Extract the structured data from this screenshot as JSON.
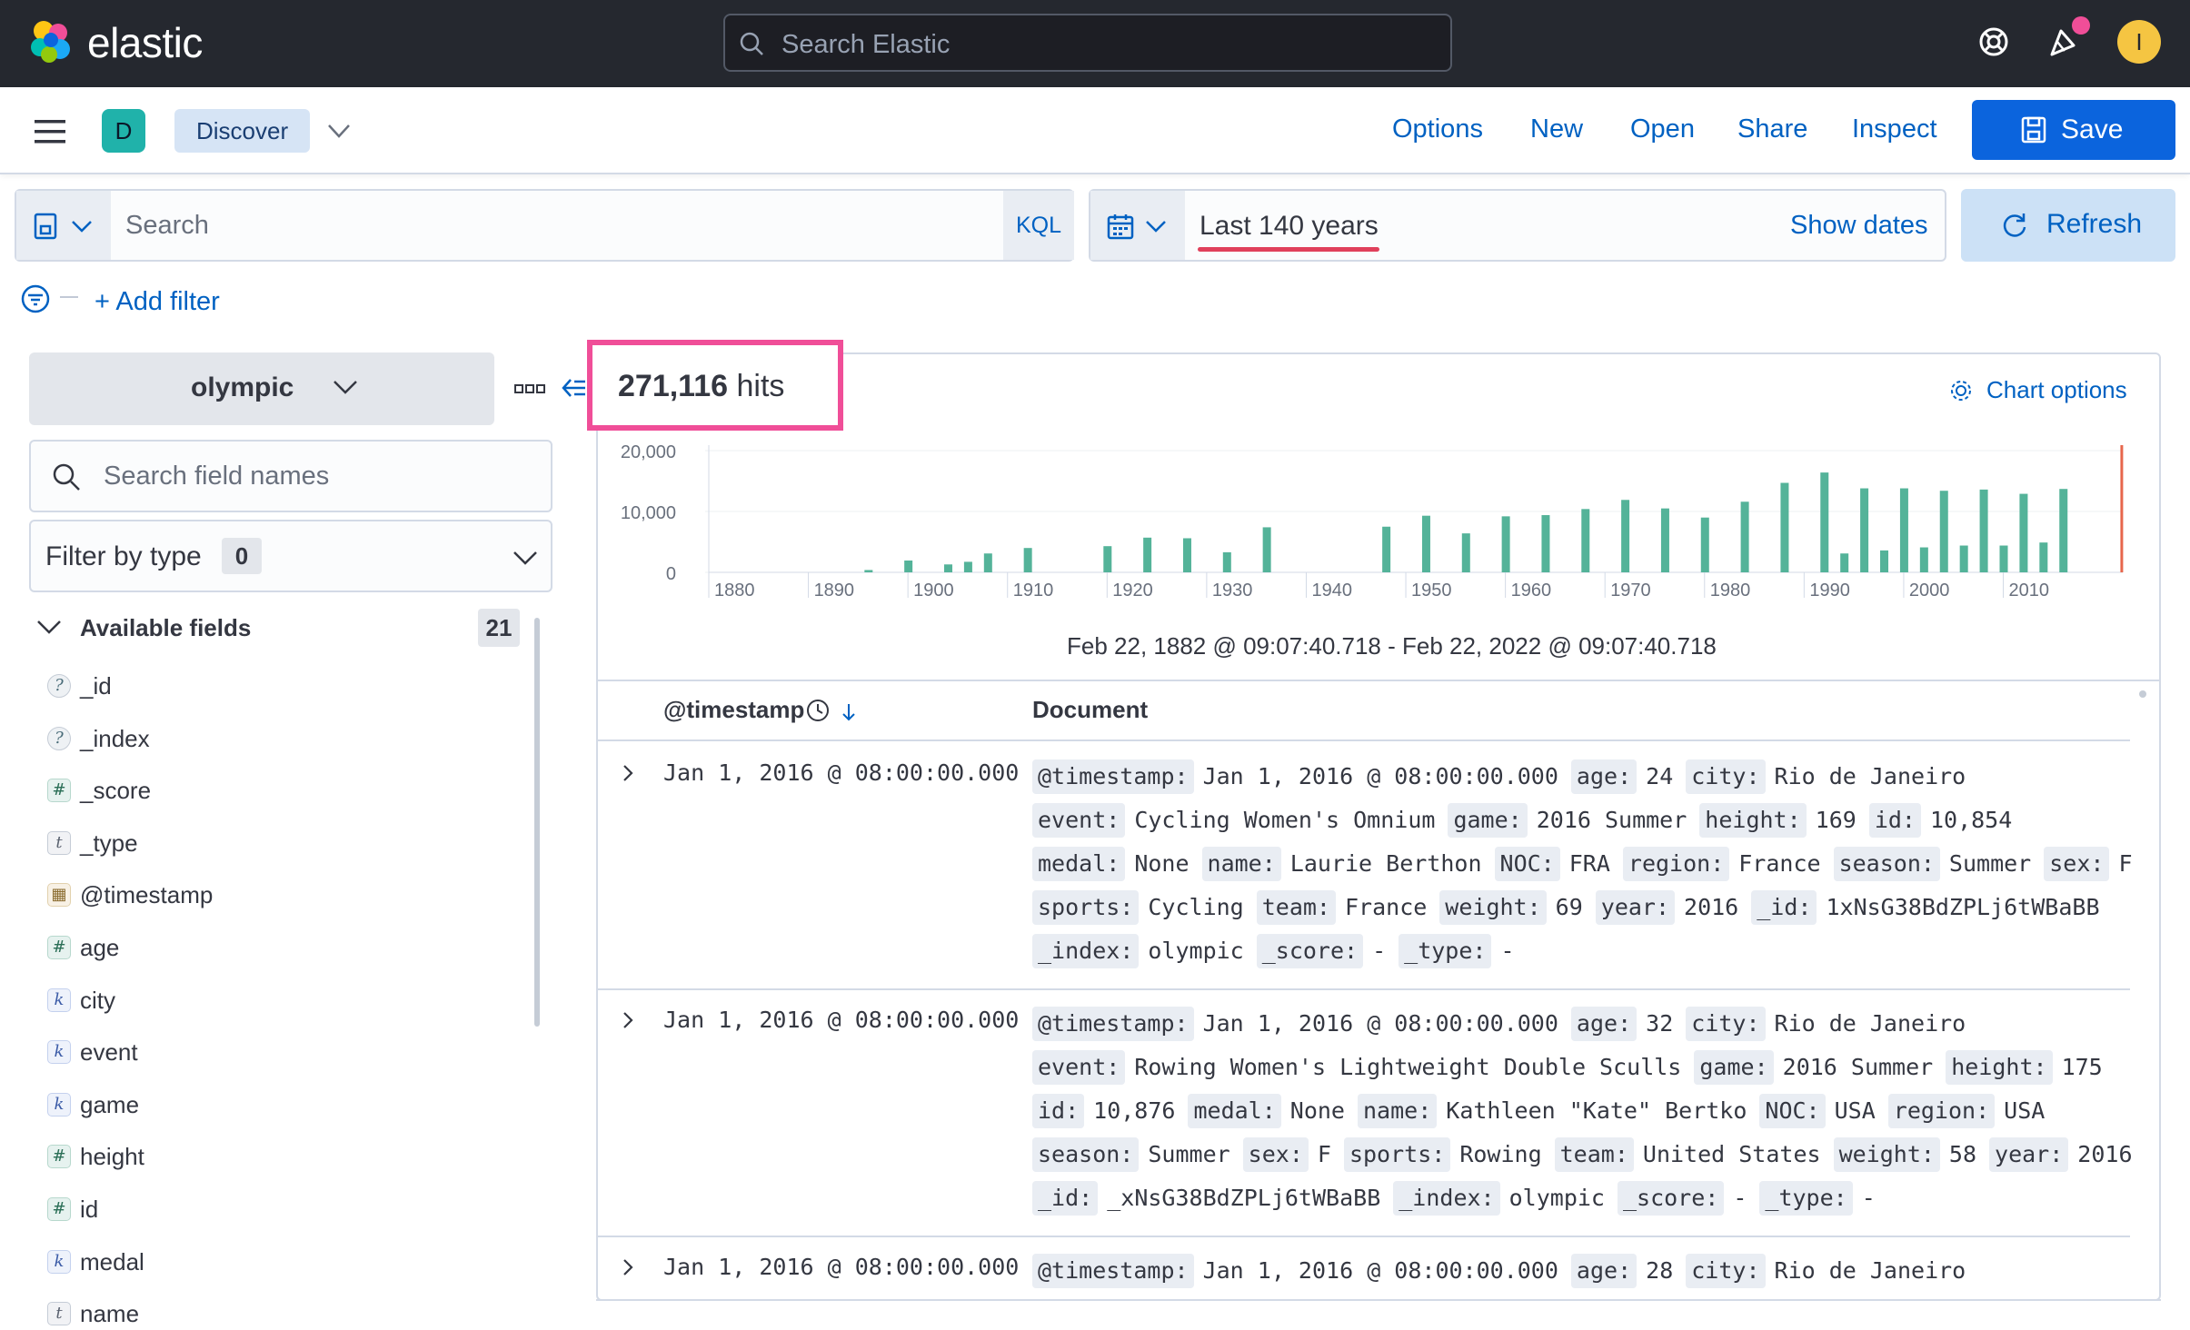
{
  "header": {
    "logo_text": "elastic",
    "search_placeholder": "Search Elastic",
    "user_initial": "I"
  },
  "appbar": {
    "space_initial": "D",
    "breadcrumb": "Discover",
    "nav": [
      "Options",
      "New",
      "Open",
      "Share",
      "Inspect"
    ],
    "save_label": "Save"
  },
  "query": {
    "placeholder": "Search",
    "language": "KQL",
    "date_range": "Last 140 years",
    "show_dates": "Show dates",
    "refresh_label": "Refresh",
    "add_filter": "+ Add filter"
  },
  "sidebar": {
    "index_pattern": "olympic",
    "field_search_placeholder": "Search field names",
    "filter_by_type": "Filter by type",
    "filter_count": "0",
    "available_label": "Available fields",
    "available_count": "21",
    "fields": [
      {
        "type": "q",
        "badge": "?",
        "name": "_id"
      },
      {
        "type": "q",
        "badge": "?",
        "name": "_index"
      },
      {
        "type": "num",
        "badge": "#",
        "name": "_score"
      },
      {
        "type": "txt",
        "badge": "t",
        "name": "_type"
      },
      {
        "type": "date",
        "badge": "▦",
        "name": "@timestamp"
      },
      {
        "type": "num",
        "badge": "#",
        "name": "age"
      },
      {
        "type": "kw",
        "badge": "k",
        "name": "city"
      },
      {
        "type": "kw",
        "badge": "k",
        "name": "event"
      },
      {
        "type": "kw",
        "badge": "k",
        "name": "game"
      },
      {
        "type": "num",
        "badge": "#",
        "name": "height"
      },
      {
        "type": "num",
        "badge": "#",
        "name": "id"
      },
      {
        "type": "kw",
        "badge": "k",
        "name": "medal"
      },
      {
        "type": "txt",
        "badge": "t",
        "name": "name"
      }
    ]
  },
  "main": {
    "hits_count": "271,116",
    "hits_word": "hits",
    "chart_options": "Chart options",
    "range_label": "Feb 22, 1882 @ 09:07:40.718 - Feb 22, 2022 @ 09:07:40.718",
    "columns": {
      "timestamp": "@timestamp",
      "document": "Document"
    },
    "rows": [
      {
        "timestamp": "Jan 1, 2016 @ 08:00:00.000",
        "lines": [
          [
            [
              "@timestamp:",
              "Jan 1, 2016 @ 08:00:00.000"
            ],
            [
              "age:",
              "24"
            ],
            [
              "city:",
              "Rio de Janeiro"
            ]
          ],
          [
            [
              "event:",
              "Cycling Women's Omnium"
            ],
            [
              "game:",
              "2016 Summer"
            ],
            [
              "height:",
              "169"
            ],
            [
              "id:",
              "10,854"
            ]
          ],
          [
            [
              "medal:",
              "None"
            ],
            [
              "name:",
              "Laurie Berthon"
            ],
            [
              "NOC:",
              "FRA"
            ],
            [
              "region:",
              "France"
            ],
            [
              "season:",
              "Summer"
            ],
            [
              "sex:",
              "F"
            ]
          ],
          [
            [
              "sports:",
              "Cycling"
            ],
            [
              "team:",
              "France"
            ],
            [
              "weight:",
              "69"
            ],
            [
              "year:",
              "2016"
            ],
            [
              "_id:",
              "1xNsG38BdZPLj6tWBaBB"
            ]
          ],
          [
            [
              "_index:",
              "olympic"
            ],
            [
              "_score:",
              " - "
            ],
            [
              "_type:",
              " - "
            ]
          ]
        ]
      },
      {
        "timestamp": "Jan 1, 2016 @ 08:00:00.000",
        "lines": [
          [
            [
              "@timestamp:",
              "Jan 1, 2016 @ 08:00:00.000"
            ],
            [
              "age:",
              "32"
            ],
            [
              "city:",
              "Rio de Janeiro"
            ]
          ],
          [
            [
              "event:",
              "Rowing Women's Lightweight Double Sculls"
            ],
            [
              "game:",
              "2016 Summer"
            ],
            [
              "height:",
              "175"
            ]
          ],
          [
            [
              "id:",
              "10,876"
            ],
            [
              "medal:",
              "None"
            ],
            [
              "name:",
              "Kathleen \"Kate\" Bertko"
            ],
            [
              "NOC:",
              "USA"
            ],
            [
              "region:",
              "USA"
            ]
          ],
          [
            [
              "season:",
              "Summer"
            ],
            [
              "sex:",
              "F"
            ],
            [
              "sports:",
              "Rowing"
            ],
            [
              "team:",
              "United States"
            ],
            [
              "weight:",
              "58"
            ],
            [
              "year:",
              "2016"
            ]
          ],
          [
            [
              "_id:",
              "_xNsG38BdZPLj6tWBaBB"
            ],
            [
              "_index:",
              "olympic"
            ],
            [
              "_score:",
              " - "
            ],
            [
              "_type:",
              " - "
            ]
          ]
        ]
      },
      {
        "timestamp": "Jan 1, 2016 @ 08:00:00.000",
        "lines": [
          [
            [
              "@timestamp:",
              "Jan 1, 2016 @ 08:00:00.000"
            ],
            [
              "age:",
              "28"
            ],
            [
              "city:",
              "Rio de Janeiro"
            ]
          ]
        ]
      }
    ]
  },
  "chart_data": {
    "type": "bar",
    "title": "",
    "xlabel": "",
    "ylabel": "",
    "x_ticks": [
      "1880",
      "1890",
      "1900",
      "1910",
      "1920",
      "1930",
      "1940",
      "1950",
      "1960",
      "1970",
      "1980",
      "1990",
      "2000",
      "2010"
    ],
    "y_ticks": [
      "20,000",
      "10,000",
      "0"
    ],
    "ylim": [
      0,
      20000
    ],
    "xlim": [
      1880,
      2022
    ],
    "bar_color": "#54b399",
    "now_marker_color": "#e7664c",
    "series": [
      {
        "values": [
          {
            "x": 1896,
            "y": 380
          },
          {
            "x": 1900,
            "y": 1940
          },
          {
            "x": 1904,
            "y": 1300
          },
          {
            "x": 1906,
            "y": 1730
          },
          {
            "x": 1908,
            "y": 3100
          },
          {
            "x": 1912,
            "y": 4000
          },
          {
            "x": 1920,
            "y": 4300
          },
          {
            "x": 1924,
            "y": 5700
          },
          {
            "x": 1928,
            "y": 5600
          },
          {
            "x": 1932,
            "y": 3300
          },
          {
            "x": 1936,
            "y": 7400
          },
          {
            "x": 1948,
            "y": 7500
          },
          {
            "x": 1952,
            "y": 9300
          },
          {
            "x": 1956,
            "y": 6400
          },
          {
            "x": 1960,
            "y": 9200
          },
          {
            "x": 1964,
            "y": 9400
          },
          {
            "x": 1968,
            "y": 10400
          },
          {
            "x": 1972,
            "y": 11900
          },
          {
            "x": 1976,
            "y": 10500
          },
          {
            "x": 1980,
            "y": 9000
          },
          {
            "x": 1984,
            "y": 11600
          },
          {
            "x": 1988,
            "y": 14700
          },
          {
            "x": 1992,
            "y": 16400
          },
          {
            "x": 1994,
            "y": 3100
          },
          {
            "x": 1996,
            "y": 13800
          },
          {
            "x": 1998,
            "y": 3600
          },
          {
            "x": 2000,
            "y": 13800
          },
          {
            "x": 2002,
            "y": 4100
          },
          {
            "x": 2004,
            "y": 13400
          },
          {
            "x": 2006,
            "y": 4400
          },
          {
            "x": 2008,
            "y": 13600
          },
          {
            "x": 2010,
            "y": 4400
          },
          {
            "x": 2012,
            "y": 12900
          },
          {
            "x": 2014,
            "y": 4900
          },
          {
            "x": 2016,
            "y": 13700
          }
        ]
      }
    ]
  }
}
